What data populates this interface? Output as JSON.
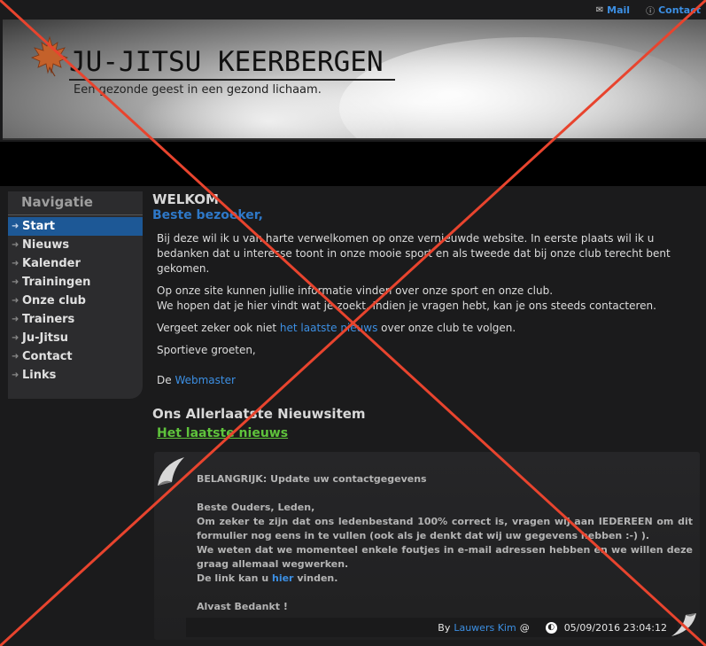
{
  "toplinks": {
    "mail": "Mail",
    "contact": "Contact"
  },
  "header": {
    "title": "JU-JITSU KEERBERGEN",
    "slogan": "Een gezonde geest in een gezond lichaam."
  },
  "sidebar": {
    "heading": "Navigatie",
    "items": [
      "Start",
      "Nieuws",
      "Kalender",
      "Trainingen",
      "Onze club",
      "Trainers",
      "Ju-Jitsu",
      "Contact",
      "Links"
    ]
  },
  "welcome": {
    "title": "WELKOM",
    "subtitle": "Beste bezoeker,",
    "p1": "Bij deze wil ik u van harte verwelkomen op onze vernieuwde website. In eerste plaats wil ik u bedanken dat u interesse toont in onze mooie sport en als tweede dat bij onze club terecht bent gekomen.",
    "p2a": "Op onze site kunnen jullie informatie vinden over onze sport en onze club.",
    "p2b": "We hopen dat je hier vindt wat je zoekt. Indien je vragen hebt, kan je ons steeds contacteren.",
    "p3_before": "Vergeet zeker ook niet ",
    "p3_link": "het laatste nieuws",
    "p3_after": " over onze club te volgen.",
    "p4": "Sportieve groeten,",
    "p5_before": "De ",
    "p5_link": "Webmaster"
  },
  "news": {
    "heading": "Ons Allerlaatste Nieuwsitem",
    "link": "Het laatste nieuws",
    "title": "BELANGRIJK: Update uw contactgegevens",
    "greeting": "Beste Ouders, Leden,",
    "line1": "Om zeker te zijn dat ons ledenbestand 100% correct is, vragen wij aan IEDEREEN om dit formulier nog eens in te vullen (ook als je denkt dat wij uw gegevens hebben :-) ).",
    "line2": "We weten dat we momenteel enkele foutjes in e-mail adressen hebben en we willen deze graag allemaal wegwerken.",
    "line3_before": "De link kan u ",
    "line3_link": "hier",
    "line3_after": " vinden.",
    "thanks": "Alvast Bedankt !",
    "by": "By",
    "author": "Lauwers Kim",
    "at": "@",
    "datetime": "05/09/2016 23:04:12"
  },
  "colors": {
    "accent": "#3c8fe3",
    "nav_active": "#1d5896",
    "news_link": "#5fc33c",
    "cross": "#e8442e"
  }
}
